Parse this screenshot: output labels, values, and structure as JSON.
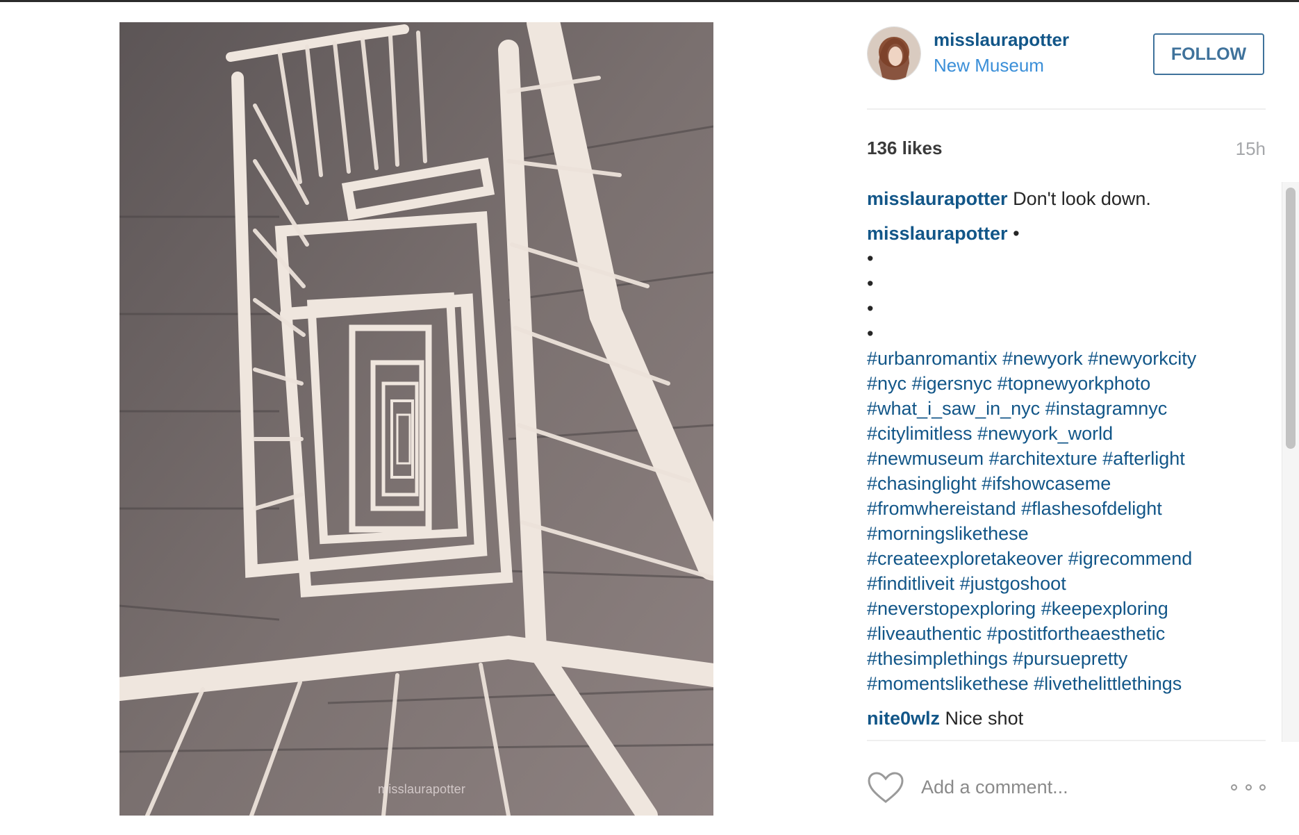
{
  "photo": {
    "watermark": "misslaurapotter"
  },
  "post": {
    "username": "misslaurapotter",
    "location": "New Museum",
    "follow_label": "FOLLOW",
    "likes": "136 likes",
    "time": "15h"
  },
  "comments": [
    {
      "user": "misslaurapotter",
      "text": "Don't look down."
    },
    {
      "user": "misslaurapotter",
      "first_text": " •",
      "bullets": [
        "•",
        "•",
        "•",
        "•"
      ],
      "hashtag_lines": [
        [
          "#urbanromantix",
          "#newyork",
          "#newyorkcity"
        ],
        [
          "#nyc",
          "#igersnyc",
          "#topnewyorkphoto"
        ],
        [
          "#what_i_saw_in_nyc",
          "#instagramnyc"
        ],
        [
          "#citylimitless",
          "#newyork_world"
        ],
        [
          "#newmuseum",
          "#architexture",
          "#afterlight"
        ],
        [
          "#chasinglight",
          "#ifshowcaseme"
        ],
        [
          "#fromwhereistand",
          "#flashesofdelight"
        ],
        [
          "#morningslikethese"
        ],
        [
          "#createexploretakeover",
          "#igrecommend"
        ],
        [
          "#finditliveit",
          "#justgoshoot"
        ],
        [
          "#neverstopexploring",
          "#keepexploring"
        ],
        [
          "#liveauthentic",
          "#postitfortheaesthetic"
        ],
        [
          "#thesimplethings",
          "#pursuepretty"
        ],
        [
          "#momentslikethese",
          "#livethelittlethings"
        ]
      ]
    },
    {
      "user": "nite0wlz",
      "text": "Nice shot"
    }
  ],
  "add_comment": {
    "placeholder": "Add a comment..."
  },
  "colors": {
    "link": "#125688",
    "location": "#3b8fd8",
    "follow_border": "#3f729b"
  }
}
